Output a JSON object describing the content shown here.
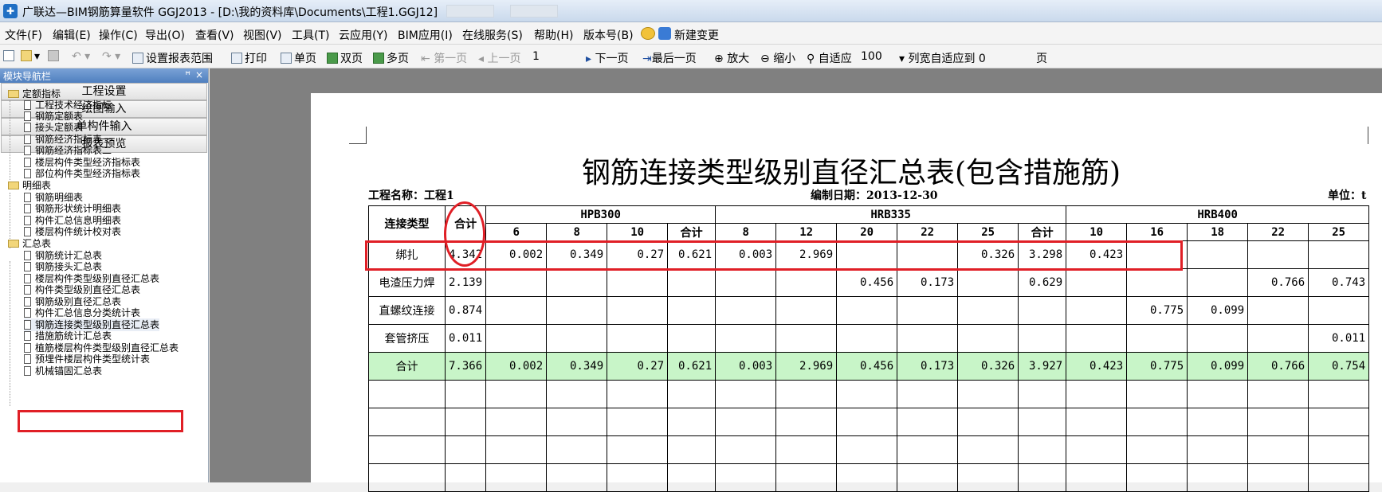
{
  "window": {
    "title": "广联达—BIM钢筋算量软件 GGJ2013 - [D:\\我的资料库\\Documents\\工程1.GGJ12]"
  },
  "menu": [
    "文件(F)",
    "编辑(E)",
    "操作(C)",
    "导出(O)",
    "查看(V)",
    "视图(V)",
    "工具(T)",
    "云应用(Y)",
    "BIM应用(I)",
    "在线服务(S)",
    "帮助(H)",
    "版本号(B)",
    "新建变更"
  ],
  "toolbar": {
    "set_range": "设置报表范围",
    "print": "打印",
    "single_page": "单页",
    "double_page": "双页",
    "multi_page": "多页",
    "first_page": "第一页",
    "prev_page": "上一页",
    "page_number": "1",
    "next_page": "下一页",
    "last_page": "最后一页",
    "zoom_in": "放大",
    "zoom_out": "缩小",
    "fit": "自适应",
    "zoom_value": "100",
    "col_fit": "列宽自适应到 0",
    "page_suffix": "页"
  },
  "nav": {
    "header": "模块导航栏",
    "pin": "ꟸ",
    "close": "×",
    "sections": [
      "工程设置",
      "绘图输入",
      "单构件输入",
      "报表预览"
    ],
    "groups": [
      {
        "label": "定额指标",
        "items": [
          "工程技术经济指标",
          "钢筋定额表",
          "接头定额表",
          "钢筋经济指标表一",
          "钢筋经济指标表二",
          "楼层构件类型经济指标表",
          "部位构件类型经济指标表"
        ]
      },
      {
        "label": "明细表",
        "items": [
          "钢筋明细表",
          "钢筋形状统计明细表",
          "构件汇总信息明细表",
          "楼层构件统计校对表"
        ]
      },
      {
        "label": "汇总表",
        "items": [
          "钢筋统计汇总表",
          "钢筋接头汇总表",
          "楼层构件类型级别直径汇总表",
          "构件类型级别直径汇总表",
          "钢筋级别直径汇总表",
          "构件汇总信息分类统计表",
          "钢筋连接类型级别直径汇总表",
          "措施筋统计汇总表",
          "植筋楼层构件类型级别直径汇总表",
          "预埋件楼层构件类型统计表",
          "机械锚固汇总表"
        ]
      }
    ],
    "selected": "钢筋连接类型级别直径汇总表"
  },
  "report": {
    "title": "钢筋连接类型级别直径汇总表(包含措施筋)",
    "project_label": "工程名称：工程1",
    "date_label": "编制日期：2013-12-30",
    "unit_label": "单位：t",
    "header": {
      "type": "连接类型",
      "total": "合计",
      "groups": [
        {
          "name": "HPB300",
          "cols": [
            "6",
            "8",
            "10",
            "合计"
          ]
        },
        {
          "name": "HRB335",
          "cols": [
            "8",
            "12",
            "20",
            "22",
            "25",
            "合计"
          ]
        },
        {
          "name": "HRB400",
          "cols": [
            "10",
            "16",
            "18",
            "22",
            "25"
          ]
        }
      ]
    },
    "rows": [
      {
        "type": "绑扎",
        "total": "4.342",
        "cells": [
          "0.002",
          "0.349",
          "0.27",
          "0.621",
          "0.003",
          "2.969",
          "",
          "",
          "0.326",
          "3.298",
          "0.423",
          "",
          "",
          "",
          ""
        ]
      },
      {
        "type": "电渣压力焊",
        "total": "2.139",
        "cells": [
          "",
          "",
          "",
          "",
          "",
          "",
          "0.456",
          "0.173",
          "",
          "0.629",
          "",
          "",
          "",
          "0.766",
          "0.743"
        ]
      },
      {
        "type": "直螺纹连接",
        "total": "0.874",
        "cells": [
          "",
          "",
          "",
          "",
          "",
          "",
          "",
          "",
          "",
          "",
          "",
          "0.775",
          "0.099",
          "",
          ""
        ]
      },
      {
        "type": "套管挤压",
        "total": "0.011",
        "cells": [
          "",
          "",
          "",
          "",
          "",
          "",
          "",
          "",
          "",
          "",
          "",
          "",
          "",
          "",
          "0.011"
        ]
      },
      {
        "type": "合计",
        "total": "7.366",
        "cells": [
          "0.002",
          "0.349",
          "0.27",
          "0.621",
          "0.003",
          "2.969",
          "0.456",
          "0.173",
          "0.326",
          "3.927",
          "0.423",
          "0.775",
          "0.099",
          "0.766",
          "0.754"
        ]
      }
    ],
    "empty_rows": 4
  },
  "colors": {
    "annotation": "#e01f26",
    "total_row": "#c8f5c8"
  }
}
